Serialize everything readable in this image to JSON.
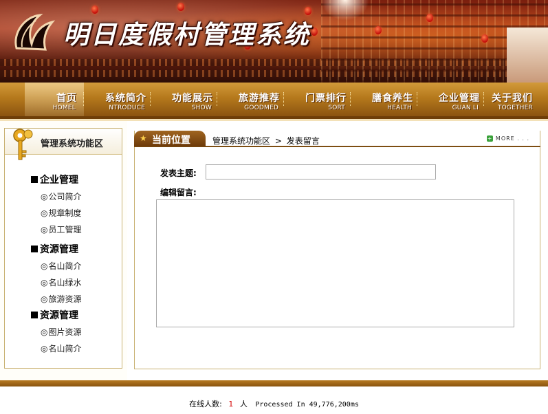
{
  "header": {
    "site_title": "明日度假村管理系统"
  },
  "nav": {
    "items": [
      {
        "cn": "首页",
        "en": "HOMEL"
      },
      {
        "cn": "系统简介",
        "en": "NTRODUCE"
      },
      {
        "cn": "功能展示",
        "en": "SHOW"
      },
      {
        "cn": "旅游推荐",
        "en": "GOODMED"
      },
      {
        "cn": "门票排行",
        "en": "SORT"
      },
      {
        "cn": "膳食养生",
        "en": "HEALTH"
      },
      {
        "cn": "企业管理",
        "en": "GUAN LI"
      },
      {
        "cn": "关于我们",
        "en": "TOGETHER"
      }
    ],
    "active_index": 0
  },
  "sidebar": {
    "title": "管理系统功能区",
    "groups": [
      {
        "title": "企业管理",
        "items": [
          "公司简介",
          "规章制度",
          "员工管理"
        ]
      },
      {
        "title": "资源管理",
        "items": [
          "名山简介",
          "名山绿水",
          "旅游资源"
        ]
      },
      {
        "title": "资源管理",
        "items": [
          "图片资源",
          "名山简介"
        ]
      }
    ],
    "bullet": "◎"
  },
  "breadcrumb": {
    "tab_label": "当前位置",
    "section": "管理系统功能区",
    "separator": ">",
    "page": "发表留言",
    "more_label": "MORE . . ."
  },
  "form": {
    "subject_label": "发表主题:",
    "subject_value": "",
    "message_label": "编辑留言:",
    "message_value": ""
  },
  "footer": {
    "online_label": "在线人数:",
    "online_count": "1",
    "online_unit": "人",
    "processed": "Processed In 49,776,200ms"
  },
  "colors": {
    "nav_gold": "#b5791c",
    "border": "#c8b070",
    "footer_red": "#d40000"
  }
}
